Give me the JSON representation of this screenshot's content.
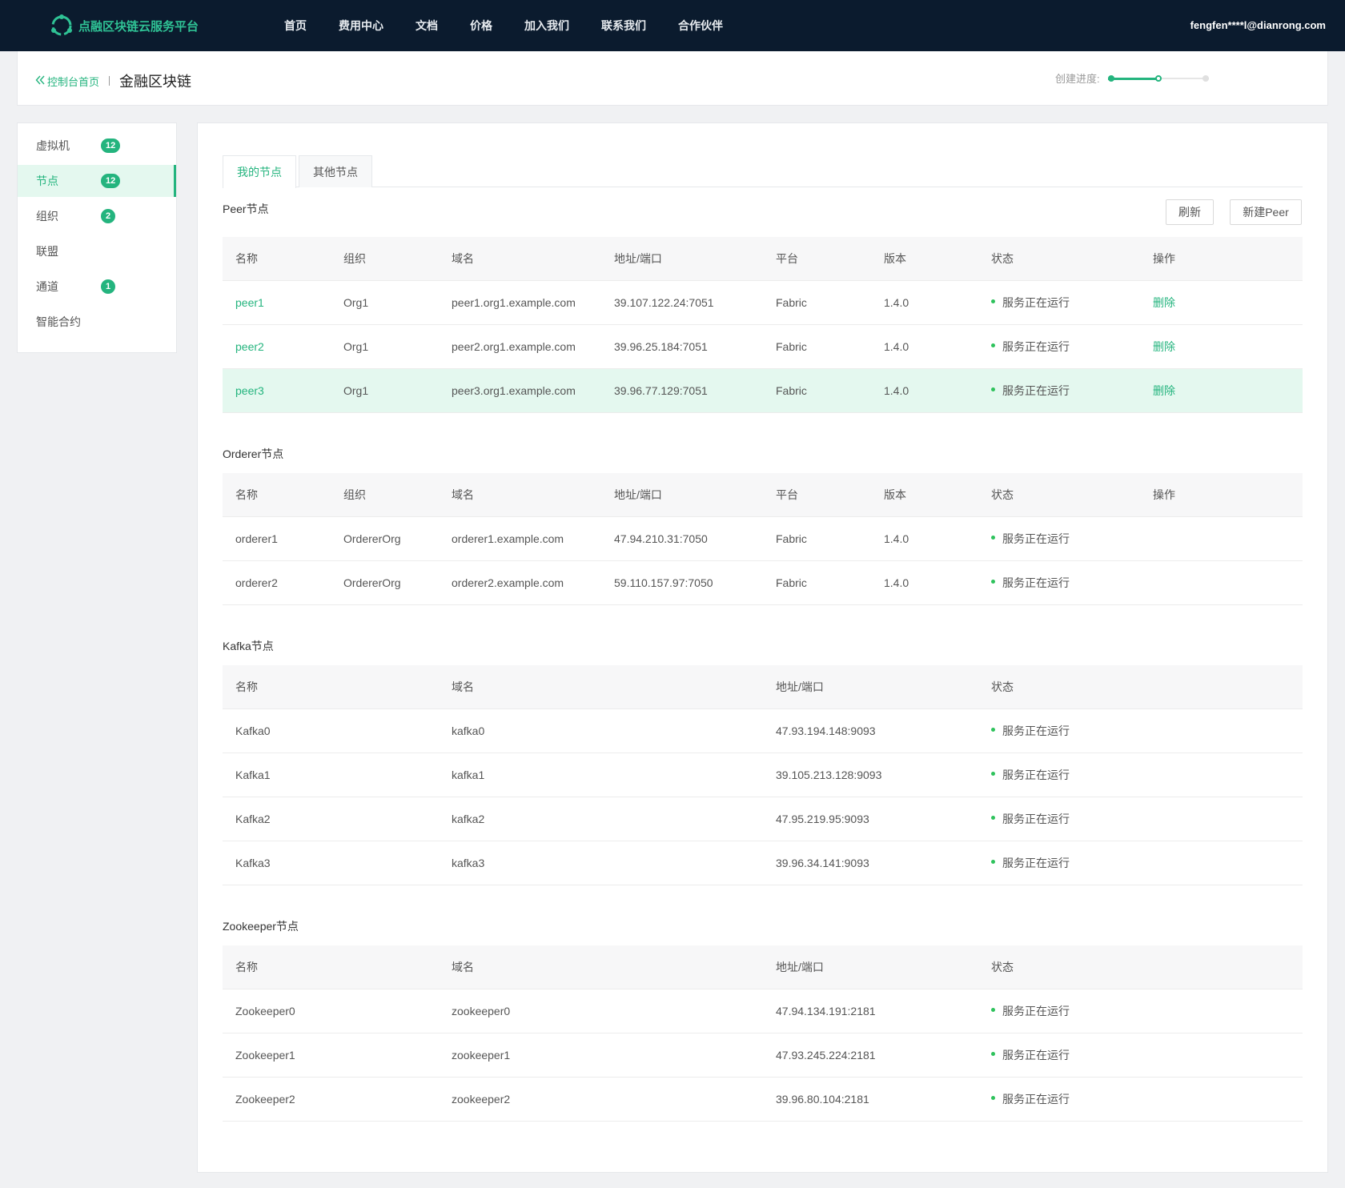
{
  "brand": {
    "name": "点融区块链云服务平台",
    "color": "#2fc295"
  },
  "nav": {
    "items": [
      "首页",
      "费用中心",
      "文档",
      "价格",
      "加入我们",
      "联系我们",
      "合作伙伴"
    ]
  },
  "user": {
    "email": "fengfen****l@dianrong.com"
  },
  "header": {
    "back_label": "控制台首页",
    "title": "金融区块链",
    "progress_label": "创建进度:",
    "progress_fraction": 0.5
  },
  "sidebar": {
    "items": [
      {
        "label": "虚拟机",
        "badge": "12"
      },
      {
        "label": "节点",
        "badge": "12",
        "active": true
      },
      {
        "label": "组织",
        "badge": "2"
      },
      {
        "label": "联盟",
        "badge": ""
      },
      {
        "label": "通道",
        "badge": "1"
      },
      {
        "label": "智能合约",
        "badge": ""
      }
    ]
  },
  "tabs": [
    "我的节点",
    "其他节点"
  ],
  "buttons": {
    "refresh": "刷新",
    "new_peer": "新建Peer"
  },
  "peer": {
    "title": "Peer节点",
    "headers": [
      "名称",
      "组织",
      "域名",
      "地址/端口",
      "平台",
      "版本",
      "状态",
      "操作"
    ],
    "rows": [
      {
        "name": "peer1",
        "org": "Org1",
        "domain": "peer1.org1.example.com",
        "addr": "39.107.122.24:7051",
        "platform": "Fabric",
        "version": "1.4.0",
        "status": "服务正在运行",
        "action": "删除"
      },
      {
        "name": "peer2",
        "org": "Org1",
        "domain": "peer2.org1.example.com",
        "addr": "39.96.25.184:7051",
        "platform": "Fabric",
        "version": "1.4.0",
        "status": "服务正在运行",
        "action": "删除"
      },
      {
        "name": "peer3",
        "org": "Org1",
        "domain": "peer3.org1.example.com",
        "addr": "39.96.77.129:7051",
        "platform": "Fabric",
        "version": "1.4.0",
        "status": "服务正在运行",
        "action": "删除"
      }
    ]
  },
  "orderer": {
    "title": "Orderer节点",
    "headers": [
      "名称",
      "组织",
      "域名",
      "地址/端口",
      "平台",
      "版本",
      "状态",
      "操作"
    ],
    "rows": [
      {
        "name": "orderer1",
        "org": "OrdererOrg",
        "domain": "orderer1.example.com",
        "addr": "47.94.210.31:7050",
        "platform": "Fabric",
        "version": "1.4.0",
        "status": "服务正在运行"
      },
      {
        "name": "orderer2",
        "org": "OrdererOrg",
        "domain": "orderer2.example.com",
        "addr": "59.110.157.97:7050",
        "platform": "Fabric",
        "version": "1.4.0",
        "status": "服务正在运行"
      }
    ]
  },
  "kafka": {
    "title": "Kafka节点",
    "headers": [
      "名称",
      "域名",
      "地址/端口",
      "状态"
    ],
    "rows": [
      {
        "name": "Kafka0",
        "domain": "kafka0",
        "addr": "47.93.194.148:9093",
        "status": "服务正在运行"
      },
      {
        "name": "Kafka1",
        "domain": "kafka1",
        "addr": "39.105.213.128:9093",
        "status": "服务正在运行"
      },
      {
        "name": "Kafka2",
        "domain": "kafka2",
        "addr": "47.95.219.95:9093",
        "status": "服务正在运行"
      },
      {
        "name": "Kafka3",
        "domain": "kafka3",
        "addr": "39.96.34.141:9093",
        "status": "服务正在运行"
      }
    ]
  },
  "zookeeper": {
    "title": "Zookeeper节点",
    "headers": [
      "名称",
      "域名",
      "地址/端口",
      "状态"
    ],
    "rows": [
      {
        "name": "Zookeeper0",
        "domain": "zookeeper0",
        "addr": "47.94.134.191:2181",
        "status": "服务正在运行"
      },
      {
        "name": "Zookeeper1",
        "domain": "zookeeper1",
        "addr": "47.93.245.224:2181",
        "status": "服务正在运行"
      },
      {
        "name": "Zookeeper2",
        "domain": "zookeeper2",
        "addr": "39.96.80.104:2181",
        "status": "服务正在运行"
      }
    ]
  },
  "colors": {
    "accent": "#24b47e",
    "topbar": "#0b1b2e",
    "status_ok": "#2ec25c"
  }
}
